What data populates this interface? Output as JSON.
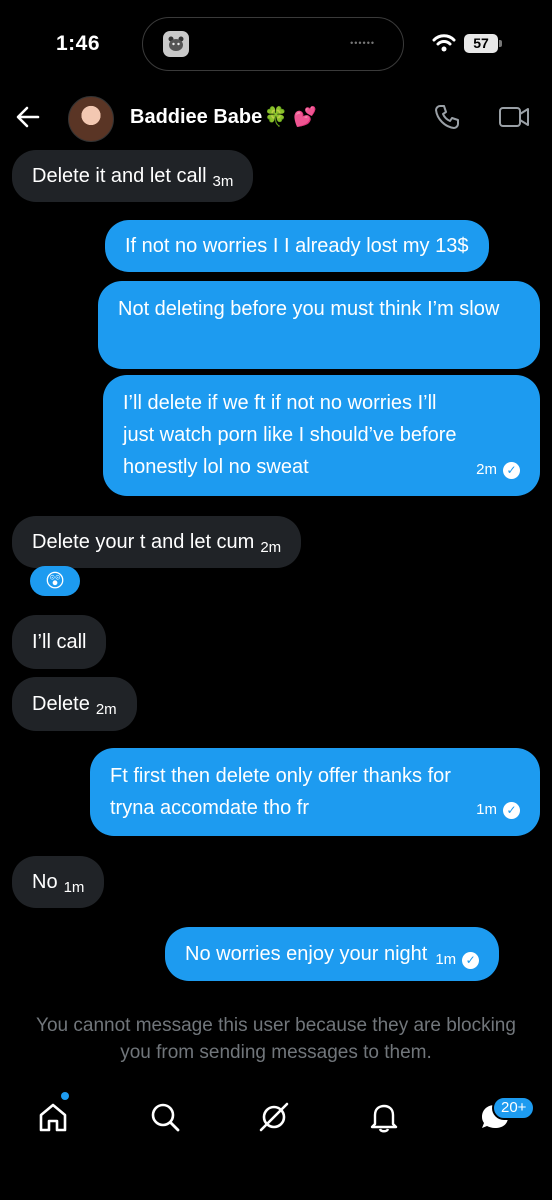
{
  "status_bar": {
    "time": "1:46",
    "battery": "57"
  },
  "header": {
    "contact_name": "Baddiee Babe",
    "name_emoji": "🍀 💕",
    "back_icon": "back-arrow-icon",
    "call_icon": "phone-icon",
    "video_icon": "video-camera-icon"
  },
  "messages": [
    {
      "dir": "in",
      "text": "Delete it and let call",
      "time": "3m"
    },
    {
      "dir": "out",
      "text": "If not no worries I I already lost my 13$"
    },
    {
      "dir": "out",
      "text": "Not deleting before you must think I’m slow"
    },
    {
      "dir": "out",
      "text": "I’ll delete if we ft if not no worries I’ll just watch porn like I should’ve before honestly lol no sweat",
      "time": "2m"
    },
    {
      "dir": "in",
      "text": "Delete your t and let cum",
      "time": "2m",
      "reaction": "😲"
    },
    {
      "dir": "in",
      "text": "I’ll call"
    },
    {
      "dir": "in",
      "text": "Delete",
      "time": "2m"
    },
    {
      "dir": "out",
      "text": "Ft first then delete only offer thanks for tryna accomdate tho fr",
      "time": "1m"
    },
    {
      "dir": "in",
      "text": "No",
      "time": "1m"
    },
    {
      "dir": "out",
      "text": "No worries enjoy your night",
      "time": "1m"
    }
  ],
  "blocked_notice": "You cannot message this user because they are blocking you from sending messages to them.",
  "tab_bar": {
    "items": [
      "home-icon",
      "search-icon",
      "grok-icon",
      "notifications-bell-icon",
      "messages-icon"
    ],
    "messages_badge": "20+"
  },
  "colors": {
    "accent": "#1d9bf0",
    "incoming_bubble": "#202327",
    "muted_text": "#71767b",
    "background": "#000000"
  }
}
